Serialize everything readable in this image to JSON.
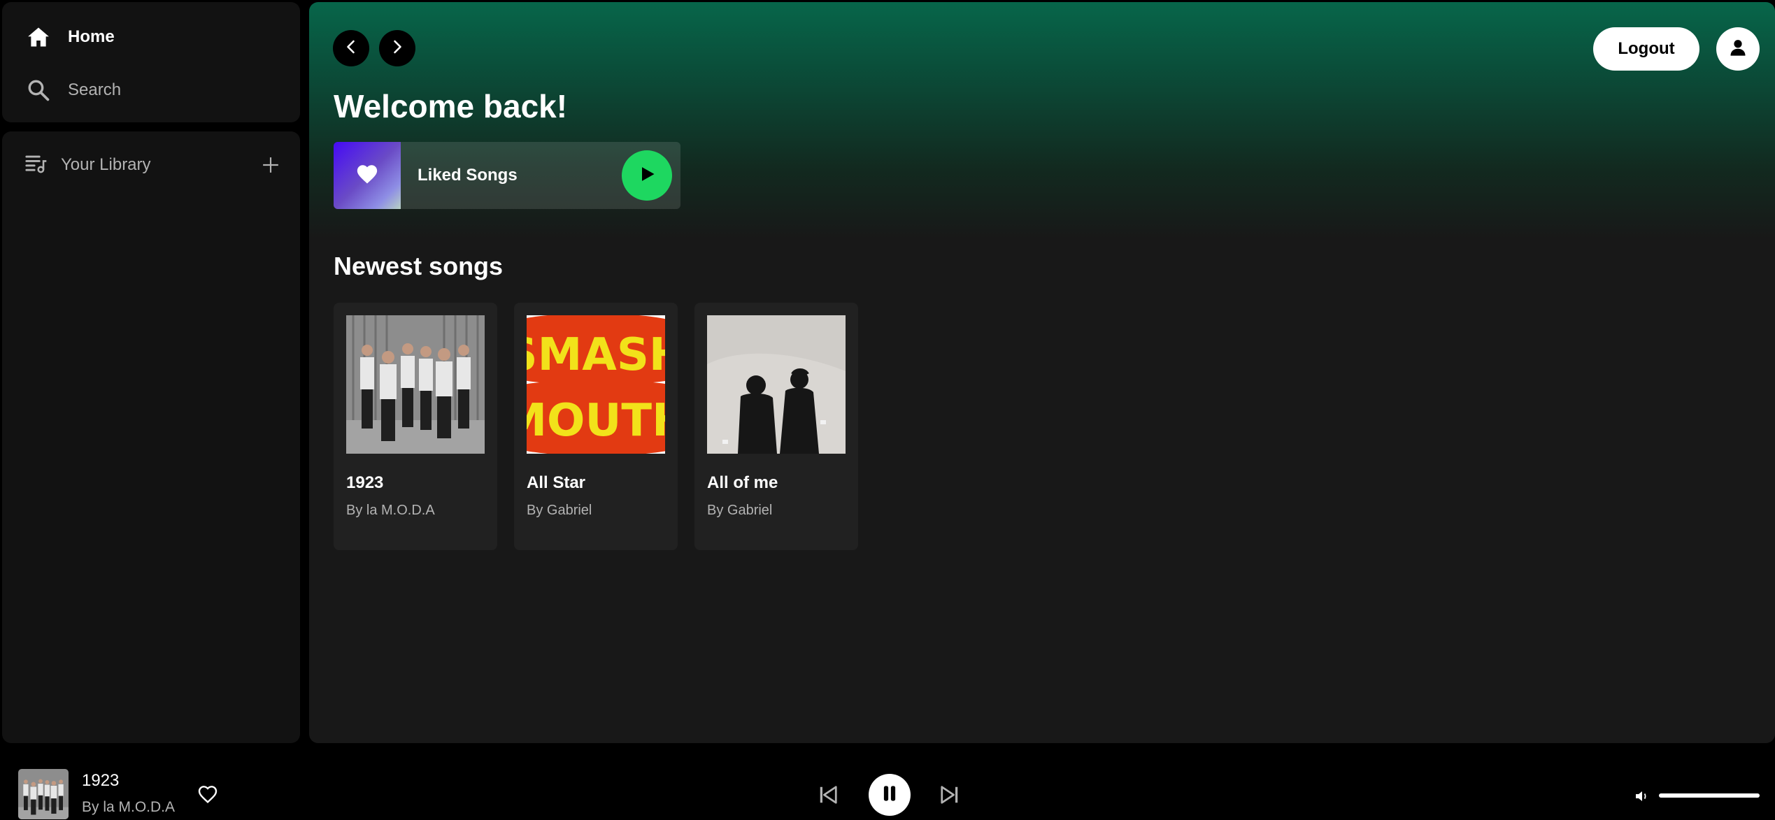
{
  "sidebar": {
    "nav": [
      {
        "label": "Home",
        "icon": "home-icon"
      },
      {
        "label": "Search",
        "icon": "search-icon"
      }
    ],
    "library": {
      "label": "Your Library",
      "icon": "library-icon",
      "add_icon": "plus-icon"
    }
  },
  "header": {
    "back_icon": "chevron-left-icon",
    "forward_icon": "chevron-right-icon",
    "logout_label": "Logout",
    "profile_icon": "user-icon"
  },
  "main": {
    "welcome_title": "Welcome back!",
    "liked_songs": {
      "label": "Liked Songs",
      "icon": "heart-icon",
      "play_icon": "play-icon"
    },
    "newest_heading": "Newest songs",
    "songs": [
      {
        "title": "1923",
        "artist": "By la M.O.D.A"
      },
      {
        "title": "All Star",
        "artist": "By Gabriel"
      },
      {
        "title": "All of me",
        "artist": "By Gabriel"
      }
    ]
  },
  "player": {
    "now_playing": {
      "title": "1923",
      "artist": "By la M.O.D.A"
    },
    "controls": {
      "prev_icon": "skip-previous-icon",
      "pause_icon": "pause-icon",
      "next_icon": "skip-next-icon"
    },
    "volume_icon": "volume-icon",
    "volume_level": 1.0
  },
  "colors": {
    "accent": "#1ed760",
    "header_gradient_top": "#07664a",
    "background": "#121212",
    "card": "#212121",
    "muted_text": "#b3b3b3"
  }
}
